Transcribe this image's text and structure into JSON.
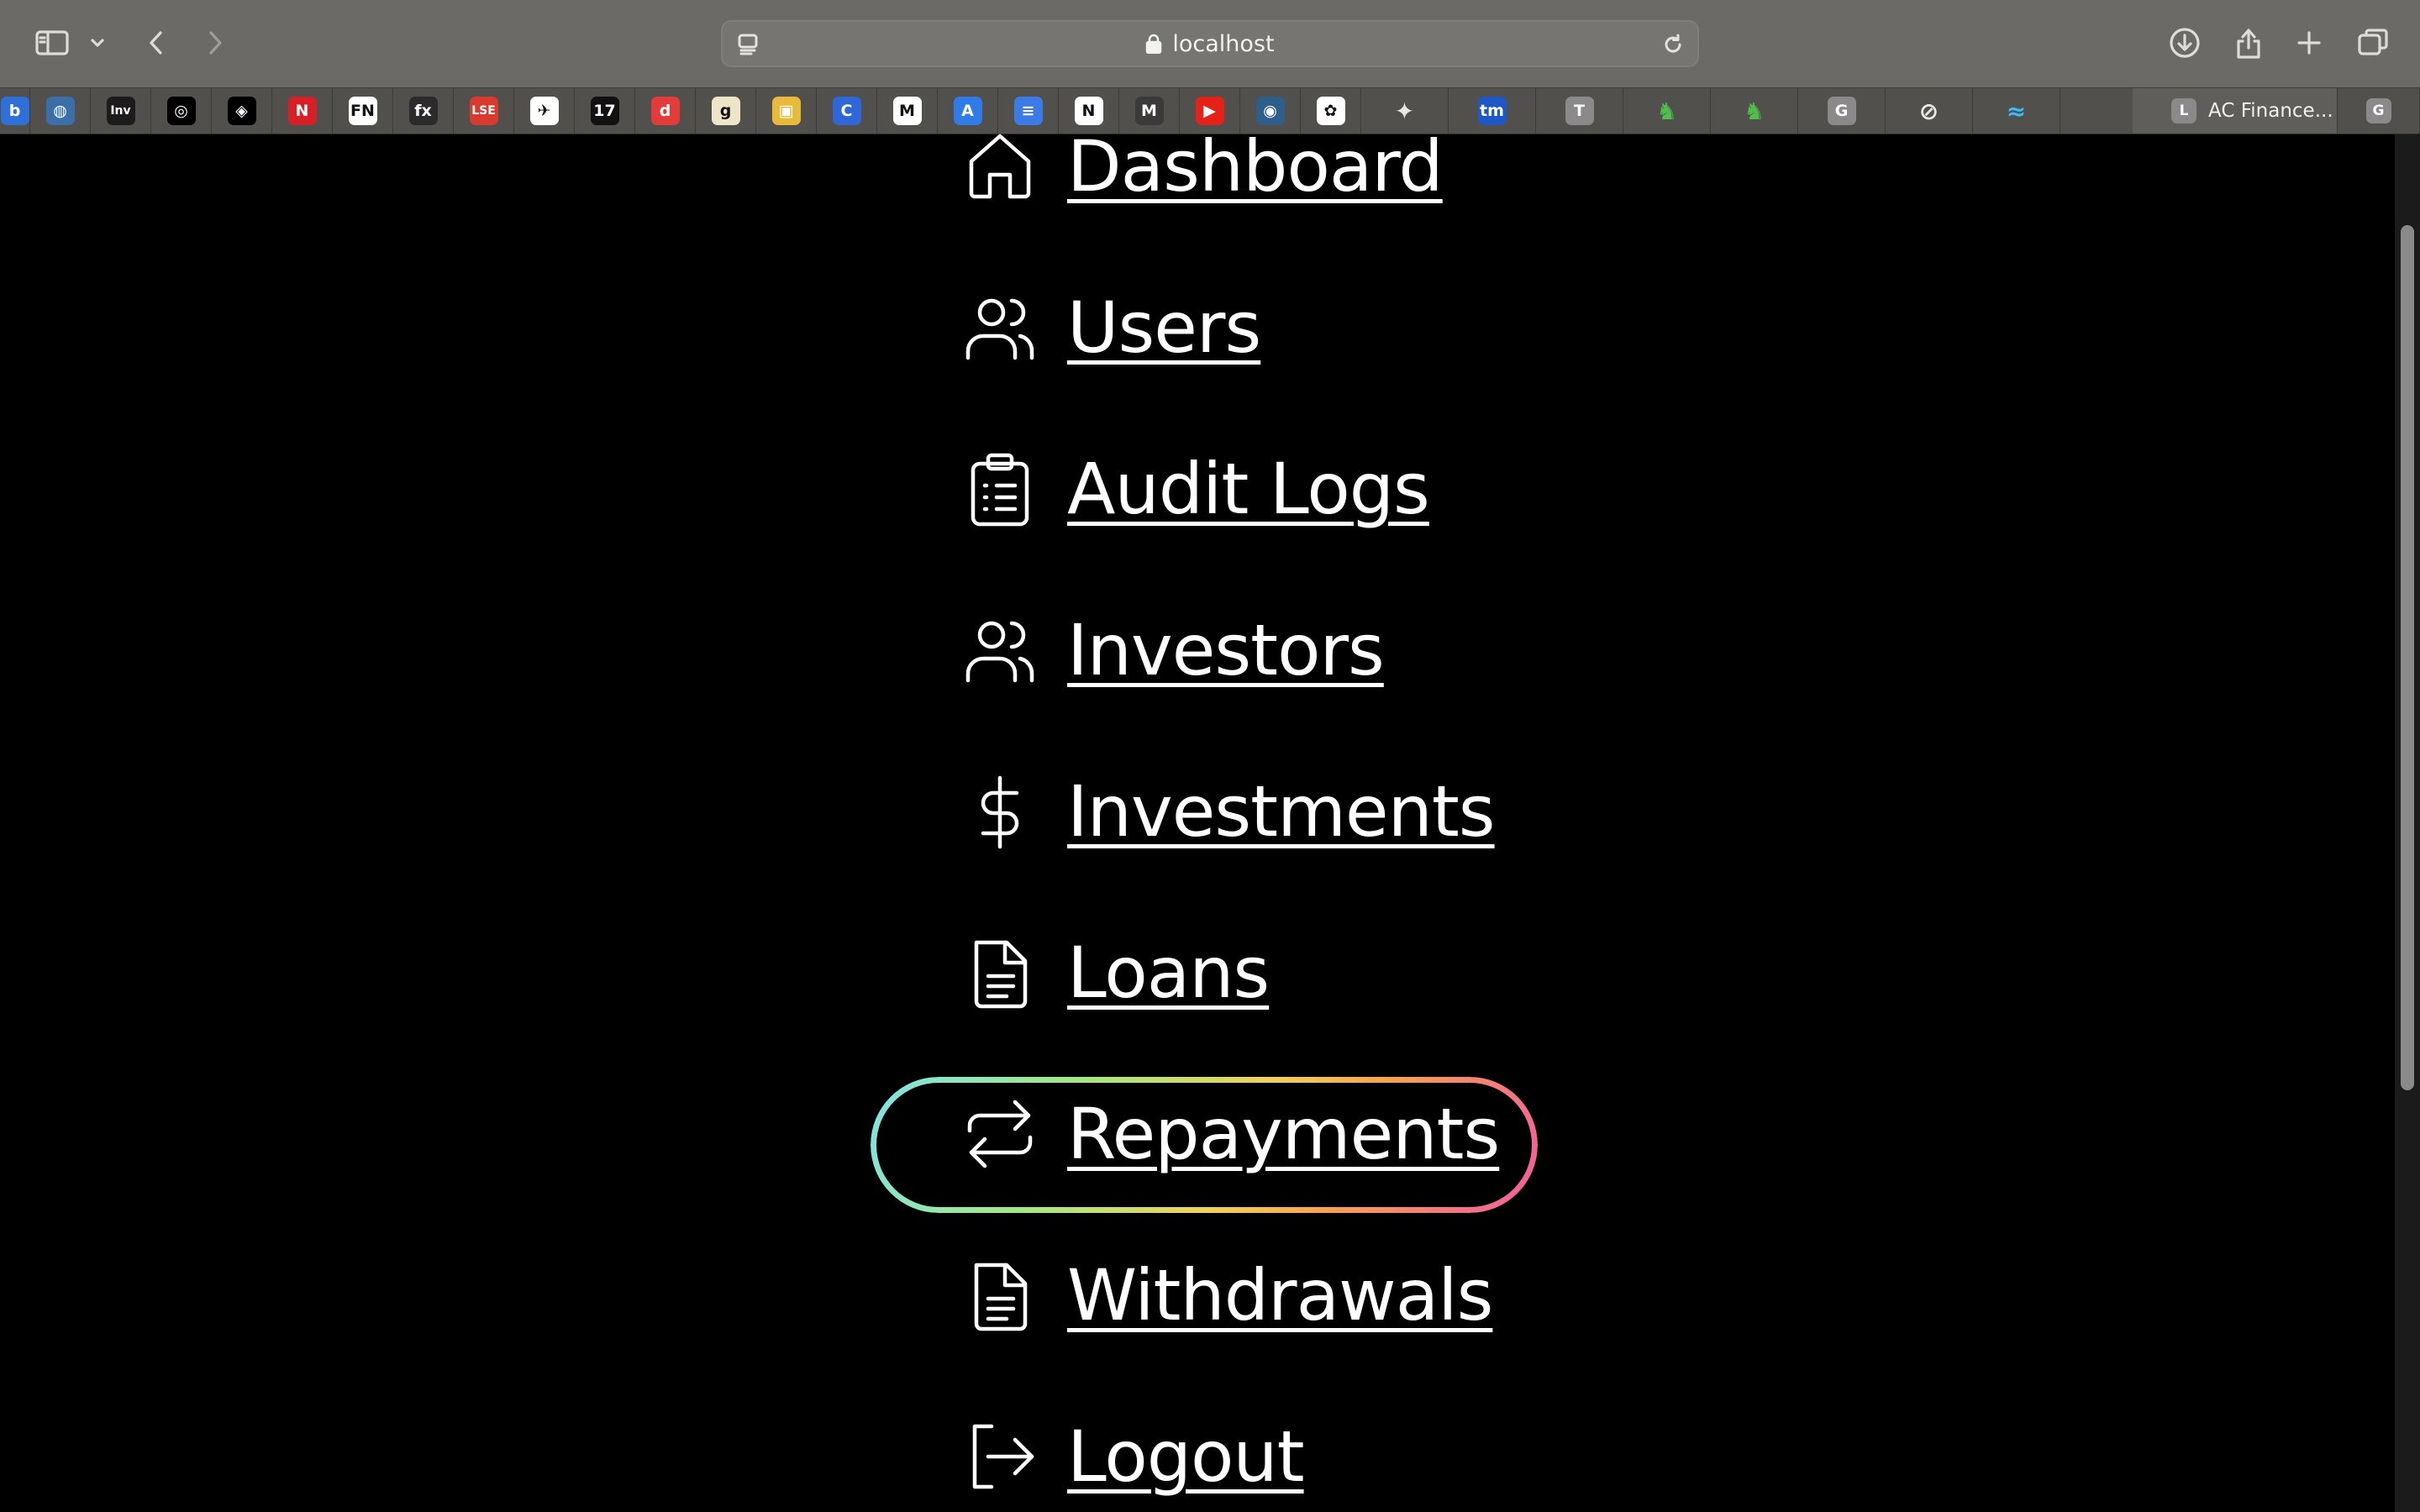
{
  "browser": {
    "url": "localhost",
    "active_tab_title": "AC Finance...",
    "bookmarks": [
      {
        "icon": "b-icon",
        "text": "b",
        "bg": "#2f6fd8"
      },
      {
        "icon": "globe-icon",
        "text": "◍",
        "bg": "#3b6fa8"
      },
      {
        "icon": "investing-icon",
        "text": "Inv",
        "bg": "#1c1c1c"
      },
      {
        "icon": "robot-icon",
        "text": "◎",
        "bg": "#000000"
      },
      {
        "icon": "compass-diamond-icon",
        "text": "◈",
        "bg": "#000000"
      },
      {
        "icon": "netflix-icon",
        "text": "N",
        "bg": "#d81f26"
      },
      {
        "icon": "fn-icon",
        "text": "FN",
        "bg": "#ffffff"
      },
      {
        "icon": "fx-icon",
        "text": "fx",
        "bg": "#2b2b2b"
      },
      {
        "icon": "lse-icon",
        "text": "LSE",
        "bg": "#d83a2e"
      },
      {
        "icon": "bird-icon",
        "text": "✈",
        "bg": "#ffffff"
      },
      {
        "icon": "tradingview-icon",
        "text": "17",
        "bg": "#111111"
      },
      {
        "icon": "d-icon",
        "text": "d",
        "bg": "#e53a3a"
      },
      {
        "icon": "goodreads-icon",
        "text": "g",
        "bg": "#eee4c8"
      },
      {
        "icon": "photo-icon",
        "text": "▣",
        "bg": "#e8b93a"
      },
      {
        "icon": "c-icon",
        "text": "C",
        "bg": "#2f66d8"
      },
      {
        "icon": "gmail-icon",
        "text": "M",
        "bg": "#ffffff"
      },
      {
        "icon": "a-icon",
        "text": "A",
        "bg": "#2f7be8"
      },
      {
        "icon": "docs-icon",
        "text": "≡",
        "bg": "#3b7be8"
      },
      {
        "icon": "notion-icon",
        "text": "N",
        "bg": "#ffffff"
      },
      {
        "icon": "m-icon",
        "text": "M",
        "bg": "#3a3a3a"
      },
      {
        "icon": "youtube-icon",
        "text": "▶",
        "bg": "#e62117"
      },
      {
        "icon": "earth-icon",
        "text": "◉",
        "bg": "#2e5f8a"
      },
      {
        "icon": "chatgpt-icon",
        "text": "✿",
        "bg": "#ffffff"
      },
      {
        "icon": "sparkle-icon",
        "text": "✦",
        "bg": "transparent"
      },
      {
        "icon": "tm-icon",
        "text": "tm",
        "bg": "#1e58c8"
      },
      {
        "icon": "t-icon",
        "text": "T",
        "bg": "#8a8a8a"
      },
      {
        "icon": "horse-icon",
        "text": "♞",
        "bg": "transparent"
      },
      {
        "icon": "horse-icon",
        "text": "♞",
        "bg": "transparent"
      },
      {
        "icon": "g-icon",
        "text": "G",
        "bg": "#8a8a8a"
      },
      {
        "icon": "safari-compass-icon",
        "text": "⊘",
        "bg": "transparent"
      },
      {
        "icon": "tailwind-icon",
        "text": "≈",
        "bg": "transparent"
      }
    ],
    "active_tab_icon": "L",
    "last_tab_icon": "G"
  },
  "nav": {
    "items": [
      {
        "key": "dashboard",
        "label": "Dashboard",
        "icon": "home-icon"
      },
      {
        "key": "users",
        "label": "Users",
        "icon": "users-icon"
      },
      {
        "key": "audit_logs",
        "label": "Audit Logs",
        "icon": "clipboard-list-icon"
      },
      {
        "key": "investors",
        "label": "Investors",
        "icon": "users-icon"
      },
      {
        "key": "investments",
        "label": "Investments",
        "icon": "dollar-icon"
      },
      {
        "key": "loans",
        "label": "Loans",
        "icon": "document-icon"
      },
      {
        "key": "repayments",
        "label": "Repayments",
        "icon": "arrows-repeat-icon",
        "focused": true
      },
      {
        "key": "withdrawals",
        "label": "Withdrawals",
        "icon": "document-icon"
      },
      {
        "key": "logout",
        "label": "Logout",
        "icon": "logout-icon"
      }
    ]
  },
  "colors": {
    "page_bg": "#000000",
    "text": "#ffffff",
    "focus_gradient": [
      "#7fe3e8",
      "#a6e87f",
      "#f0d25a",
      "#f7a54d",
      "#f05aa0"
    ]
  }
}
